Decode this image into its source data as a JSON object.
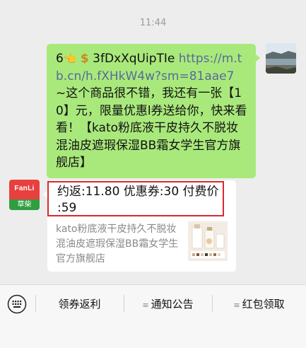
{
  "chat": {
    "timestamp": "11:44"
  },
  "outgoing": {
    "prefix": "6",
    "token": "3fDxXqUipTIe",
    "link": "https://m.tb.cn/h.fXHkW4w?sm=81aae7",
    "body": " ~这个商品很不错，我还有一张【10】元，限量优惠l券送给你，快来看看！【kato粉底液干皮持久不脱妆混油皮遮瑕保湿BB霜女学生官方旗舰店】"
  },
  "bot": {
    "avatar_brand": "FanLi",
    "avatar_tag": "草柴",
    "rebate_line1": "约返:11.80 优惠券:30 付费价",
    "rebate_line2": ":59",
    "product_name": "kato粉底液干皮持久不脱妆混油皮遮瑕保湿BB霜女学生官方旗舰店"
  },
  "bottom_menu": {
    "items": [
      {
        "label": "领券返利"
      },
      {
        "label": "通知公告"
      },
      {
        "label": "红包领取"
      }
    ]
  },
  "colors": {
    "chat_bg": "#ededed",
    "outgoing_bubble": "#a9e97c",
    "link": "#576b95",
    "highlight_border": "#d9292e",
    "bot_avatar": "#e8403f"
  },
  "icons": {
    "keyboard": "keyboard-icon",
    "pointing_hand": "pointing-hand-icon",
    "dollar": "dollar-icon"
  }
}
